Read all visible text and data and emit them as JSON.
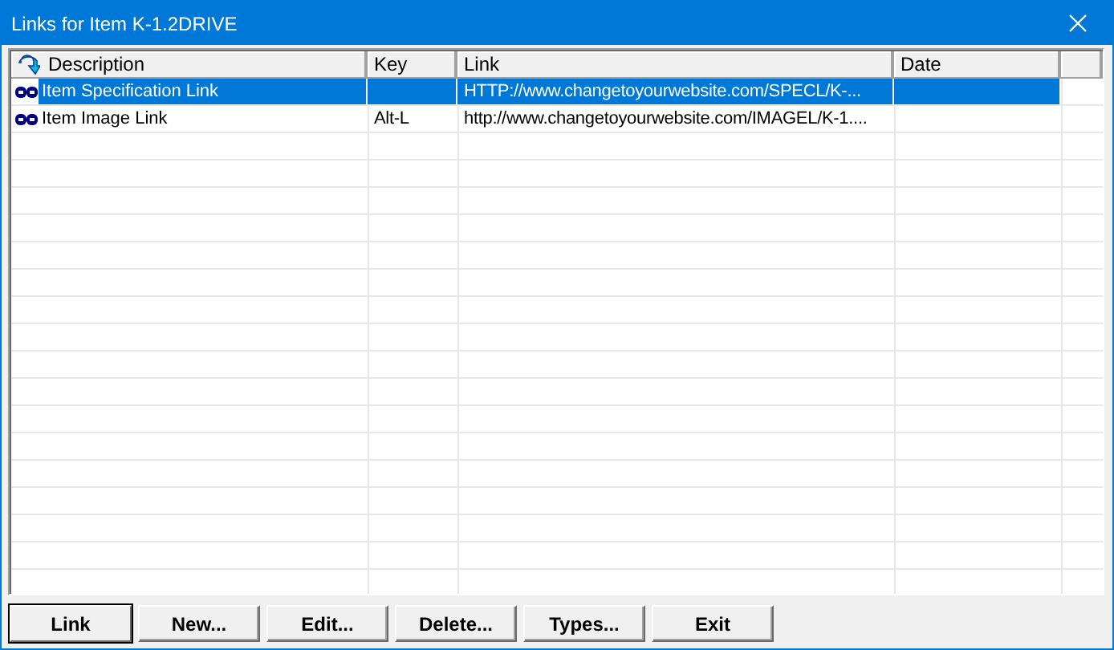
{
  "window": {
    "title": "Links for Item K-1.2DRIVE"
  },
  "table": {
    "columns": [
      "Description",
      "Key",
      "Link",
      "Date"
    ],
    "rows": [
      {
        "description": "Item Specification Link",
        "key": "",
        "link": "HTTP://www.changetoyourwebsite.com/SPECL/K-...",
        "date": "",
        "selected": true
      },
      {
        "description": "Item Image Link",
        "key": "Alt-L",
        "link": "http://www.changetoyourwebsite.com/IMAGEL/K-1....",
        "date": "",
        "selected": false
      }
    ]
  },
  "buttons": [
    {
      "label": "Link",
      "default": true
    },
    {
      "label": "New...",
      "default": false
    },
    {
      "label": "Edit...",
      "default": false
    },
    {
      "label": "Delete...",
      "default": false
    },
    {
      "label": "Types...",
      "default": false
    },
    {
      "label": "Exit",
      "default": false
    }
  ]
}
